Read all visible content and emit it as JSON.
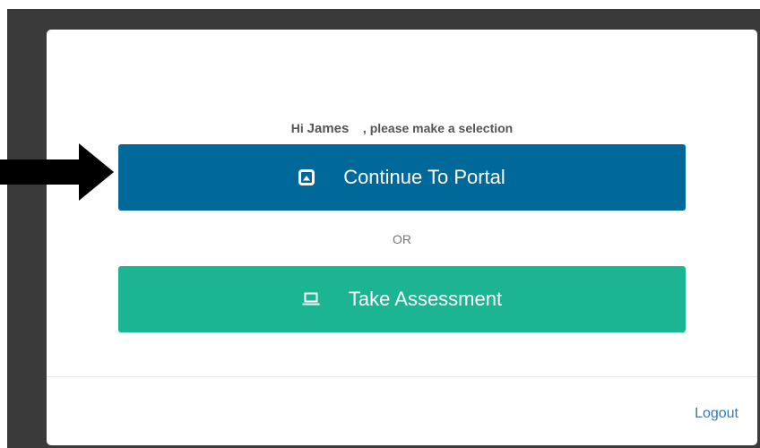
{
  "modal": {
    "greeting_prefix": "Hi ",
    "user_name": "James",
    "greeting_suffix": "    , please make a selection",
    "portal_button_label": "Continue To Portal",
    "separator_label": "OR",
    "assessment_button_label": "Take Assessment",
    "logout_label": "Logout"
  },
  "icons": {
    "portal": "portal-square-icon",
    "assessment": "laptop-icon",
    "pointer": "right-arrow-icon"
  },
  "colors": {
    "portal_button": "#006999",
    "assessment_button": "#1cb594",
    "link": "#337ab7",
    "backdrop": "#3a3a3a"
  }
}
